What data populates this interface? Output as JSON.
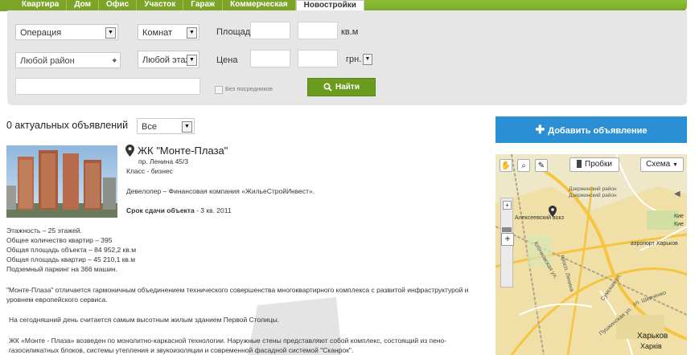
{
  "tabs": [
    "Квартира",
    "Дом",
    "Офис",
    "Участок",
    "Гараж",
    "Коммерческая",
    "Новостройки"
  ],
  "filters": {
    "operation": "Операция",
    "rooms": "Комнат",
    "area_label": "Площадь",
    "area_unit": "кв.м",
    "district": "Любой район",
    "floor": "Любой этаж",
    "price_label": "Цена",
    "currency": "грн.",
    "no_agents": "Без посредников",
    "search_button": "Найти"
  },
  "results": {
    "count_label": "0 актуальных объявлений",
    "show_select": "Все"
  },
  "add_button": "Добавить объявление",
  "listing": {
    "title": "ЖК \"Монте-Плаза\"",
    "address": "пр. Ленина 45/3",
    "class": "Класс - бизнес",
    "developer": "Девелопер – Финансовая компания «ЖильеСтройИнвест».",
    "deadline_label": "Срок сдачи объекта",
    "deadline_value": " - 3 кв. 2011",
    "specs": [
      "Этажность – 25 этажей.",
      "Общее количество квартир – 395",
      "Общая площадь объекта – 84 952,2 кв.м",
      "Общая площадь квартир – 45 210,1 кв.м",
      "Подземный паркинг на 366 машин."
    ],
    "para1": "\"Монте-Плаза\" отличается гармоничным объединением технического совершенства многоквартирного комплекса с развитой инфраструктурой и уровнем европейского сервиса.",
    "para2": "На сегодняшний день считается самым высотным жилым зданием Первой Столицы.",
    "para3": "ЖК «Монте - Плаза» возведен по монолитно-каркасной технологии. Наружные стены представляют собой комплекс, состоящий из  пено-газосиликатных блоков, системы утепления и звукоизоляции и современной фасадной системой \"Сканрок\"."
  },
  "map": {
    "traffic_button": "Пробки",
    "scheme_button": "Схема",
    "labels": {
      "district": "Дзержинский район",
      "district2": "Дзержинский район",
      "poi": "Алексеевский вокз",
      "airport": "аэропорт Харьков",
      "city": "Харьков",
      "city2": "Харків",
      "street1": "просп. Ленина",
      "street2": "Клочковская ул.",
      "street3": "Сумская ул.",
      "street4": "Пушкинская ул.",
      "street5": "ул. Шевченко",
      "street6": "Кие",
      "street7": "Кие"
    }
  },
  "colors": {
    "green": "#7ba428",
    "blue": "#2b8fd4",
    "panel": "#e6e6e6"
  }
}
